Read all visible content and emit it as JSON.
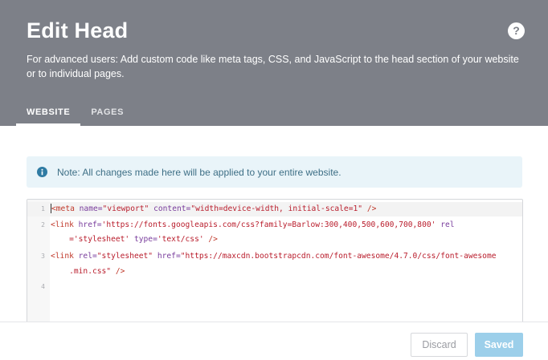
{
  "header": {
    "title": "Edit Head",
    "help_icon": "?",
    "subtitle": "For advanced users: Add custom code like meta tags, CSS, and JavaScript to the head section of your website or to individual pages."
  },
  "tabs": [
    {
      "label": "WEBSITE",
      "active": true
    },
    {
      "label": "PAGES",
      "active": false
    }
  ],
  "note": {
    "icon": "info-circle-icon",
    "text": "Note: All changes made here will be applied to your entire website."
  },
  "editor": {
    "line_numbers": [
      "1",
      "2",
      "3",
      "4"
    ],
    "lines": [
      {
        "parts": [
          {
            "t": "tg",
            "v": "<meta "
          },
          {
            "t": "at",
            "v": "name="
          },
          {
            "t": "st",
            "v": "\"viewport\" "
          },
          {
            "t": "at",
            "v": "content="
          },
          {
            "t": "st",
            "v": "\"width=device-width, initial-scale=1\" "
          },
          {
            "t": "tg",
            "v": "/>"
          }
        ]
      },
      {
        "parts": [
          {
            "t": "tg",
            "v": "<link "
          },
          {
            "t": "at",
            "v": "href="
          },
          {
            "t": "st",
            "v": "'https://fonts.googleapis.com/css?family=Barlow:300,400,500,600,700,800' "
          },
          {
            "t": "at",
            "v": "rel"
          }
        ]
      },
      {
        "parts": [
          {
            "t": "st",
            "v": "    ='stylesheet' "
          },
          {
            "t": "at",
            "v": "type="
          },
          {
            "t": "st",
            "v": "'text/css' "
          },
          {
            "t": "tg",
            "v": "/>"
          }
        ]
      },
      {
        "parts": [
          {
            "t": "tg",
            "v": "<link "
          },
          {
            "t": "at",
            "v": "rel="
          },
          {
            "t": "st",
            "v": "\"stylesheet\" "
          },
          {
            "t": "at",
            "v": "href="
          },
          {
            "t": "st",
            "v": "\"https://maxcdn.bootstrapcdn.com/font-awesome/4.7.0/css/font-awesome"
          }
        ]
      },
      {
        "parts": [
          {
            "t": "st",
            "v": "    .min.css\" "
          },
          {
            "t": "tg",
            "v": "/>"
          }
        ]
      }
    ]
  },
  "footer": {
    "discard_label": "Discard",
    "saved_label": "Saved"
  },
  "colors": {
    "header_bg": "#7d8088",
    "note_bg": "#e9f4f9",
    "saved_button": "#9ccfea"
  }
}
